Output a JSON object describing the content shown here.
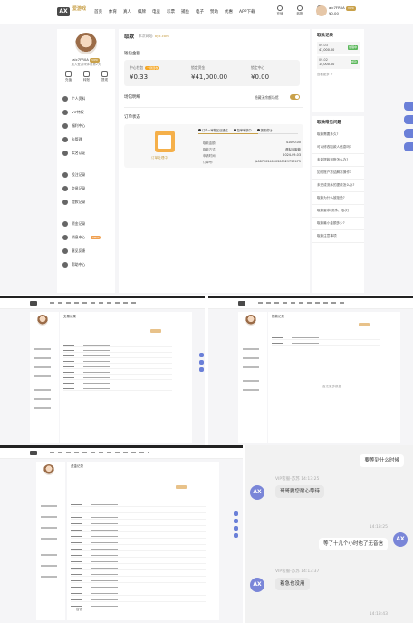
{
  "header": {
    "logo_text": "AX",
    "brand": "爱游戏",
    "nav": [
      "首页",
      "体育",
      "真人",
      "棋牌",
      "电竞",
      "彩票",
      "捕鱼",
      "电子",
      "赞助",
      "优惠",
      "APP下载"
    ],
    "icons": [
      {
        "label": "充值",
        "icon": "wallet-icon"
      },
      {
        "label": "转账",
        "icon": "transfer-icon"
      },
      {
        "label": "提现",
        "icon": "withdraw-icon"
      }
    ],
    "username": "aic7FR0A",
    "vip": "VIP0",
    "balance_label": "¥0.00"
  },
  "sidebar": {
    "name": "aic7FR0A",
    "vip": "VIP0",
    "sub": "加入爱游戏体育第2天",
    "quick": [
      "充值",
      "转账",
      "提现"
    ],
    "groups": [
      [
        {
          "label": "个人资料",
          "icon": "user-icon"
        },
        {
          "label": "VIP特权",
          "icon": "crown-icon"
        },
        {
          "label": "福利中心",
          "icon": "gift-icon"
        },
        {
          "label": "卡管理",
          "icon": "card-icon"
        },
        {
          "label": "实名认证",
          "icon": "id-icon"
        }
      ],
      [
        {
          "label": "投注记录",
          "icon": "bet-icon"
        },
        {
          "label": "交易记录",
          "icon": "record-icon"
        },
        {
          "label": "提款记录",
          "icon": "list-icon"
        }
      ],
      [
        {
          "label": "资金记录",
          "icon": "money-icon"
        },
        {
          "label": "消息中心",
          "icon": "bell-icon",
          "badge": "NEW"
        },
        {
          "label": "意见反馈",
          "icon": "feedback-icon"
        },
        {
          "label": "帮助中心",
          "icon": "help-icon"
        }
      ]
    ]
  },
  "main": {
    "title": "取款",
    "title_note": "本次网站:",
    "title_url": "ayx.com",
    "wallet_title": "钱包金额",
    "wallet": [
      {
        "label": "中心钱包",
        "value": "¥0.33",
        "pill": "一键回收"
      },
      {
        "label": "锁定资金",
        "value": "¥41,000.00"
      },
      {
        "label": "锁定中心",
        "value": "¥0.00"
      }
    ],
    "section_field": "场馆明细",
    "toggle_label": "隐藏无余额场馆",
    "order_title": "订单状态",
    "order_steps": [
      "订单一审核区已通过",
      "复审审核中",
      "提现成功",
      "已到账"
    ],
    "order_icon_label": "订单处理中",
    "order_rows": [
      {
        "label": "取款金额:",
        "value": "41000.00"
      },
      {
        "label": "取款方式:",
        "value": "虚拟币取款"
      },
      {
        "label": "申请时间:",
        "value": "2024-09-03"
      },
      {
        "label": "订单号:",
        "value": "JL0872024090300929757475"
      }
    ]
  },
  "right": {
    "record_title": "取款记录",
    "records": [
      {
        "date": "09-03",
        "amount": "41,000.00",
        "status": "处理中"
      },
      {
        "date": "09-02",
        "amount": "14,000.00",
        "status": "成功"
      }
    ],
    "more": "查看更多 >",
    "faq_title": "取款常见问题",
    "faq": [
      "取款需要多久?",
      "可以修改取款人信息吗?",
      "未能提款到账怎么办?",
      "如何账户冻结解冻操作?",
      "未完成流水的提款怎么办?",
      "取款为什么被拒绝?",
      "取款要求(流水、限次)",
      "取款最小金额多少?",
      "取款注意事项"
    ]
  },
  "mini1": {
    "title": "交易记录",
    "empty": ""
  },
  "mini2": {
    "title": "提款记录",
    "empty": "暂无更多数据"
  },
  "mini3": {
    "title": "资金记录",
    "total": "合计"
  },
  "chat": {
    "messages": [
      {
        "from": "me",
        "text": "要等到什么时候"
      },
      {
        "from": "agent",
        "name": "VIP客服-苏苏",
        "time": "14:13:25",
        "text": "哥哥要您耐心等待"
      },
      {
        "from": "time",
        "text": "14:13:25"
      },
      {
        "from": "me",
        "text": "等了十几个小时也了无音信"
      },
      {
        "from": "agent",
        "name": "VIP客服-苏苏",
        "time": "14:13:37",
        "text": "着急也没用"
      },
      {
        "from": "time",
        "text": "14:13:43"
      }
    ],
    "avatar_text": "AX"
  }
}
